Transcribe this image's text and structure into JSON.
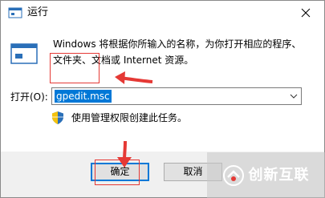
{
  "window": {
    "title": "运行"
  },
  "dialog": {
    "description": "Windows 将根据你所输入的名称，为你打开相应的程序、文件夹、文档或 Internet 资源。",
    "open_label": "打开(O):",
    "command_value": "gpedit.msc",
    "admin_note": "使用管理权限创建此任务。"
  },
  "buttons": {
    "ok_label": "确定",
    "cancel_label": "取消"
  },
  "watermark": {
    "text": "创新互联"
  },
  "colors": {
    "selection": "#0078d7",
    "annotation": "#e53935"
  },
  "icons": {
    "title": "run-icon",
    "big": "run-icon",
    "close": "close-icon",
    "dropdown": "chevron-down-icon",
    "shield": "uac-shield-icon"
  }
}
